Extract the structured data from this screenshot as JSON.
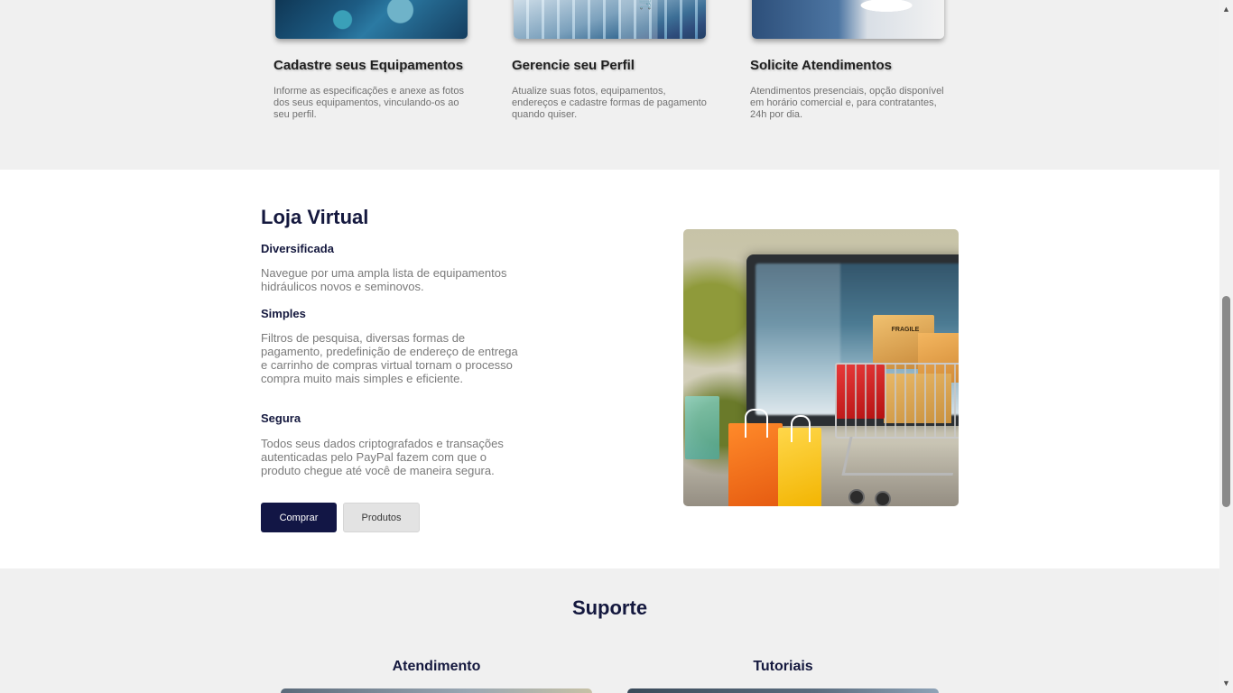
{
  "features": {
    "cards": [
      {
        "title": "Cadastre seus Equipamentos",
        "text": "Informe as especificações e anexe as fotos dos seus equipamentos, vinculando-os ao seu perfil.",
        "image": "hydraulic-equipment-photo"
      },
      {
        "title": "Gerencie seu Perfil",
        "text": "Atualize suas fotos, equipamentos, endereços e cadastre formas de pagamento quando quiser.",
        "image": "laptop-cart-photo"
      },
      {
        "title": "Solicite Atendimentos",
        "text": "Atendimentos presenciais, opção disponível em horário comercial e, para contratantes, 24h por dia.",
        "image": "technician-clipboard-photo"
      }
    ]
  },
  "store": {
    "title": "Loja Virtual",
    "sections": [
      {
        "heading": "Diversificada",
        "text": "Navegue por uma ampla lista de equipamentos hidráulicos novos e seminovos."
      },
      {
        "heading": "Simples",
        "text": "Filtros de pesquisa, diversas formas de pagamento, predefinição de endereço de entrega e carrinho de compras virtual tornam o processo compra muito mais simples e eficiente."
      },
      {
        "heading": "Segura",
        "text": "Todos seus dados criptografados e transações autenticadas pelo PayPal fazem com que o produto chegue até você de maneira segura."
      }
    ],
    "buy_label": "Comprar",
    "products_label": "Produtos",
    "image": "shopping-cart-laptop-photo",
    "image_box_label": "FRAGILE"
  },
  "support": {
    "title": "Suporte",
    "columns": [
      {
        "title": "Atendimento"
      },
      {
        "title": "Tutoriais"
      }
    ]
  },
  "colors": {
    "navy": "#121645",
    "heading": "#14183e",
    "band_bg": "#f0f0f0"
  }
}
